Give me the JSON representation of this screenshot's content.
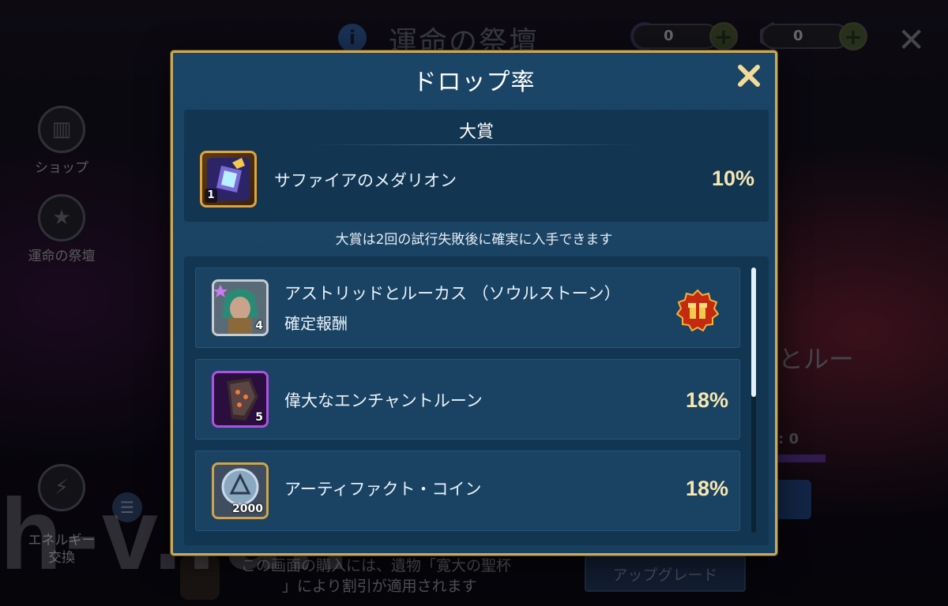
{
  "background": {
    "title": "運命の祭壇",
    "resources": [
      {
        "icon": "lightning-orb-icon",
        "value": "0"
      },
      {
        "icon": "crystal-gem-icon",
        "value": "0"
      }
    ],
    "side_buttons": [
      {
        "label": "ショップ",
        "icon": "shop-icon"
      },
      {
        "label": "運命の祭壇",
        "icon": "star-altar-icon"
      },
      {
        "label": "エネルギー\n交換",
        "icon": "energy-exchange-icon"
      }
    ],
    "right_text": "とルー",
    "right_value": ": 0",
    "bottom_text_line1": "この画面の購入には、遺物「寛大の聖杯",
    "bottom_text_line2": "」により割引が適用されます",
    "upgrade_label": "アップグレード",
    "watermark": "h-v.fun"
  },
  "modal": {
    "title": "ドロップ率",
    "grand_prize": {
      "heading": "大賞",
      "item": {
        "name": "サファイアのメダリオン",
        "badge": "1",
        "percent": "10%",
        "icon": "sapphire-medallion-icon"
      }
    },
    "guarantee_note": "大賞は2回の試行失敗後に確実に入手できます",
    "items": [
      {
        "name": "アストリッドとルーカス （ソウルストーン）",
        "sub": "確定報酬",
        "badge": "4",
        "icon": "astrid-lucas-soulstone-icon",
        "reward_icon": "gift-badge-icon"
      },
      {
        "name": "偉大なエンチャントルーン",
        "badge": "5",
        "percent": "18%",
        "icon": "enchant-rune-icon"
      },
      {
        "name": "アーティファクト・コイン",
        "count": "2000",
        "percent": "18%",
        "icon": "artifact-coin-icon"
      }
    ]
  },
  "colors": {
    "frame_gold": "#c9a85c",
    "panel_blue": "#1b4566",
    "percent_text": "#f6e7b0"
  }
}
